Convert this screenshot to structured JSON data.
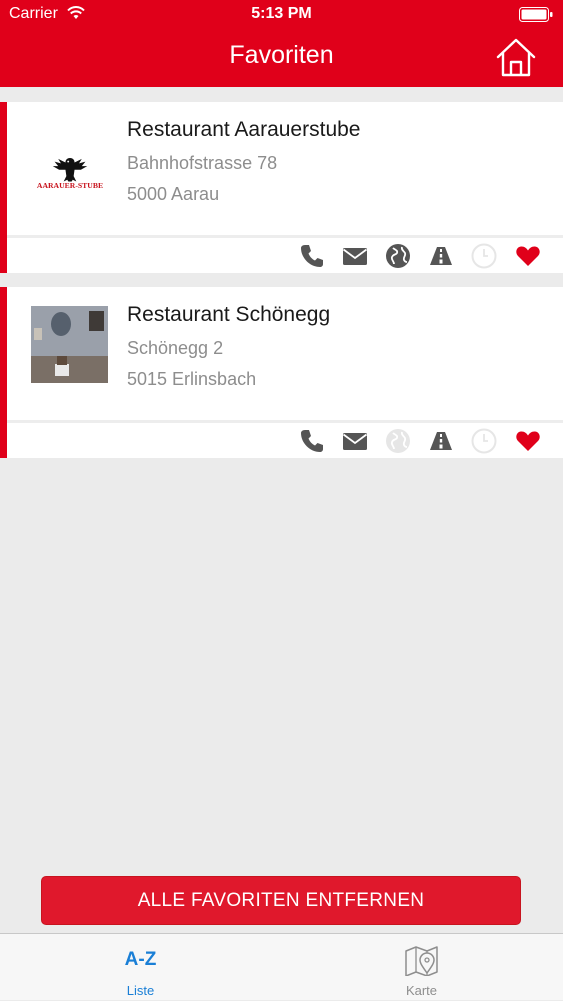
{
  "status_bar": {
    "carrier": "Carrier",
    "time": "5:13 PM"
  },
  "header": {
    "title": "Favoriten"
  },
  "favorites": [
    {
      "name": "Restaurant Aarauerstube",
      "street": "Bahnhofstrasse 78",
      "city": "5000 Aarau",
      "logo_text": "AARAUER-STUBE",
      "web_available": true
    },
    {
      "name": "Restaurant Schönegg",
      "street": "Schönegg 2",
      "city": "5015 Erlinsbach",
      "web_available": false
    }
  ],
  "remove_all_label": "ALLE FAVORITEN ENTFERNEN",
  "tabs": [
    {
      "label": "Liste",
      "glyph": "A-Z",
      "active": true
    },
    {
      "label": "Karte",
      "active": false
    }
  ],
  "colors": {
    "brand_red": "#e0001a",
    "tab_active": "#1a7fd6",
    "icon_gray": "#555555",
    "icon_disabled": "#e6e6e6"
  }
}
